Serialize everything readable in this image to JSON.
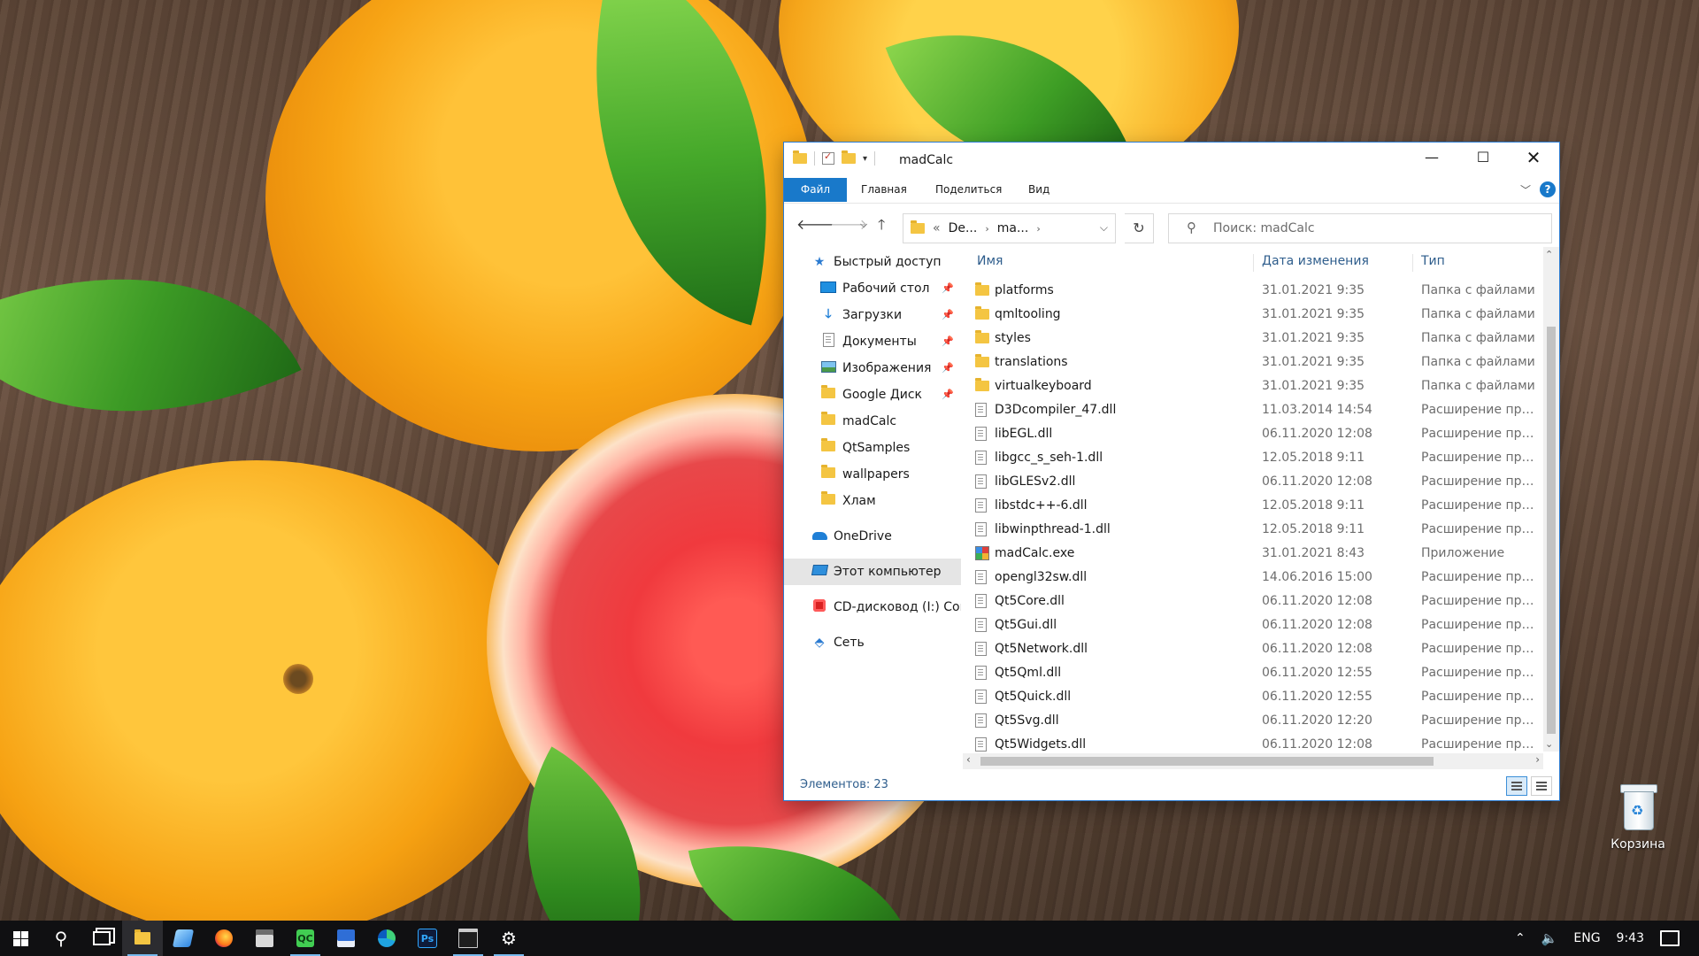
{
  "desktop": {
    "recycle_bin_label": "Корзина"
  },
  "window": {
    "title": "madCalc",
    "ribbon_tabs": [
      "Файл",
      "Главная",
      "Поделиться",
      "Вид"
    ],
    "help_label": "?",
    "address": {
      "overflow": "«",
      "segments": [
        "De...",
        "ma..."
      ]
    },
    "search_placeholder": "Поиск: madCalc",
    "nav": [
      {
        "label": "Быстрый доступ",
        "icon": "star-icon",
        "pinned": false
      },
      {
        "label": "Рабочий стол",
        "icon": "desktop-icon",
        "pinned": true
      },
      {
        "label": "Загрузки",
        "icon": "downloads-icon",
        "pinned": true
      },
      {
        "label": "Документы",
        "icon": "documents-icon",
        "pinned": true
      },
      {
        "label": "Изображения",
        "icon": "pictures-icon",
        "pinned": true
      },
      {
        "label": "Google Диск",
        "icon": "folder-icon",
        "pinned": true
      },
      {
        "label": "madCalc",
        "icon": "folder-icon",
        "pinned": false
      },
      {
        "label": "QtSamples",
        "icon": "folder-icon",
        "pinned": false
      },
      {
        "label": "wallpapers",
        "icon": "folder-icon",
        "pinned": false
      },
      {
        "label": "Хлам",
        "icon": "folder-icon",
        "pinned": false
      },
      {
        "label": "OneDrive",
        "icon": "cloud-icon",
        "pinned": false
      },
      {
        "label": "Этот компьютер",
        "icon": "computer-icon",
        "pinned": false
      },
      {
        "label": "CD-дисковод (I:) Cor",
        "icon": "cd-drive-icon",
        "pinned": false
      },
      {
        "label": "Сеть",
        "icon": "network-icon",
        "pinned": false
      }
    ],
    "columns": {
      "name": "Имя",
      "date": "Дата изменения",
      "type": "Тип"
    },
    "files": [
      {
        "name": "platforms",
        "date": "31.01.2021 9:35",
        "type": "Папка с файлами",
        "kind": "folder"
      },
      {
        "name": "qmltooling",
        "date": "31.01.2021 9:35",
        "type": "Папка с файлами",
        "kind": "folder"
      },
      {
        "name": "styles",
        "date": "31.01.2021 9:35",
        "type": "Папка с файлами",
        "kind": "folder"
      },
      {
        "name": "translations",
        "date": "31.01.2021 9:35",
        "type": "Папка с файлами",
        "kind": "folder"
      },
      {
        "name": "virtualkeyboard",
        "date": "31.01.2021 9:35",
        "type": "Папка с файлами",
        "kind": "folder"
      },
      {
        "name": "D3Dcompiler_47.dll",
        "date": "11.03.2014 14:54",
        "type": "Расширение при...",
        "kind": "dll"
      },
      {
        "name": "libEGL.dll",
        "date": "06.11.2020 12:08",
        "type": "Расширение при...",
        "kind": "dll"
      },
      {
        "name": "libgcc_s_seh-1.dll",
        "date": "12.05.2018 9:11",
        "type": "Расширение при...",
        "kind": "dll"
      },
      {
        "name": "libGLESv2.dll",
        "date": "06.11.2020 12:08",
        "type": "Расширение при...",
        "kind": "dll"
      },
      {
        "name": "libstdc++-6.dll",
        "date": "12.05.2018 9:11",
        "type": "Расширение при...",
        "kind": "dll"
      },
      {
        "name": "libwinpthread-1.dll",
        "date": "12.05.2018 9:11",
        "type": "Расширение при...",
        "kind": "dll"
      },
      {
        "name": "madCalc.exe",
        "date": "31.01.2021 8:43",
        "type": "Приложение",
        "kind": "exe"
      },
      {
        "name": "opengl32sw.dll",
        "date": "14.06.2016 15:00",
        "type": "Расширение при...",
        "kind": "dll"
      },
      {
        "name": "Qt5Core.dll",
        "date": "06.11.2020 12:08",
        "type": "Расширение при...",
        "kind": "dll"
      },
      {
        "name": "Qt5Gui.dll",
        "date": "06.11.2020 12:08",
        "type": "Расширение при...",
        "kind": "dll"
      },
      {
        "name": "Qt5Network.dll",
        "date": "06.11.2020 12:08",
        "type": "Расширение при...",
        "kind": "dll"
      },
      {
        "name": "Qt5Qml.dll",
        "date": "06.11.2020 12:55",
        "type": "Расширение при...",
        "kind": "dll"
      },
      {
        "name": "Qt5Quick.dll",
        "date": "06.11.2020 12:55",
        "type": "Расширение при...",
        "kind": "dll"
      },
      {
        "name": "Qt5Svg.dll",
        "date": "06.11.2020 12:20",
        "type": "Расширение при...",
        "kind": "dll"
      },
      {
        "name": "Qt5Widgets.dll",
        "date": "06.11.2020 12:08",
        "type": "Расширение при...",
        "kind": "dll"
      }
    ],
    "status": "Элементов: 23"
  },
  "taskbar": {
    "apps": [
      {
        "name": "start",
        "icon": "windows-logo-icon"
      },
      {
        "name": "search",
        "icon": "search-icon"
      },
      {
        "name": "task-view",
        "icon": "task-view-icon"
      },
      {
        "name": "file-explorer",
        "icon": "folder-icon",
        "active": true
      },
      {
        "name": "app-blue",
        "icon": "blue-app-icon"
      },
      {
        "name": "firefox",
        "icon": "firefox-icon"
      },
      {
        "name": "calculator",
        "icon": "calculator-icon"
      },
      {
        "name": "qt-creator",
        "icon": "qt-creator-icon",
        "badge": "QC"
      },
      {
        "name": "save-app",
        "icon": "floppy-icon"
      },
      {
        "name": "edge",
        "icon": "edge-icon"
      },
      {
        "name": "photoshop",
        "icon": "photoshop-icon",
        "badge": "Ps"
      },
      {
        "name": "terminal",
        "icon": "terminal-icon"
      },
      {
        "name": "settings",
        "icon": "gear-icon"
      }
    ],
    "tray": {
      "language": "ENG",
      "time": "9:43"
    }
  },
  "colors": {
    "accent": "#1979ca",
    "taskbar": "#101012",
    "folder": "#f4c542"
  }
}
